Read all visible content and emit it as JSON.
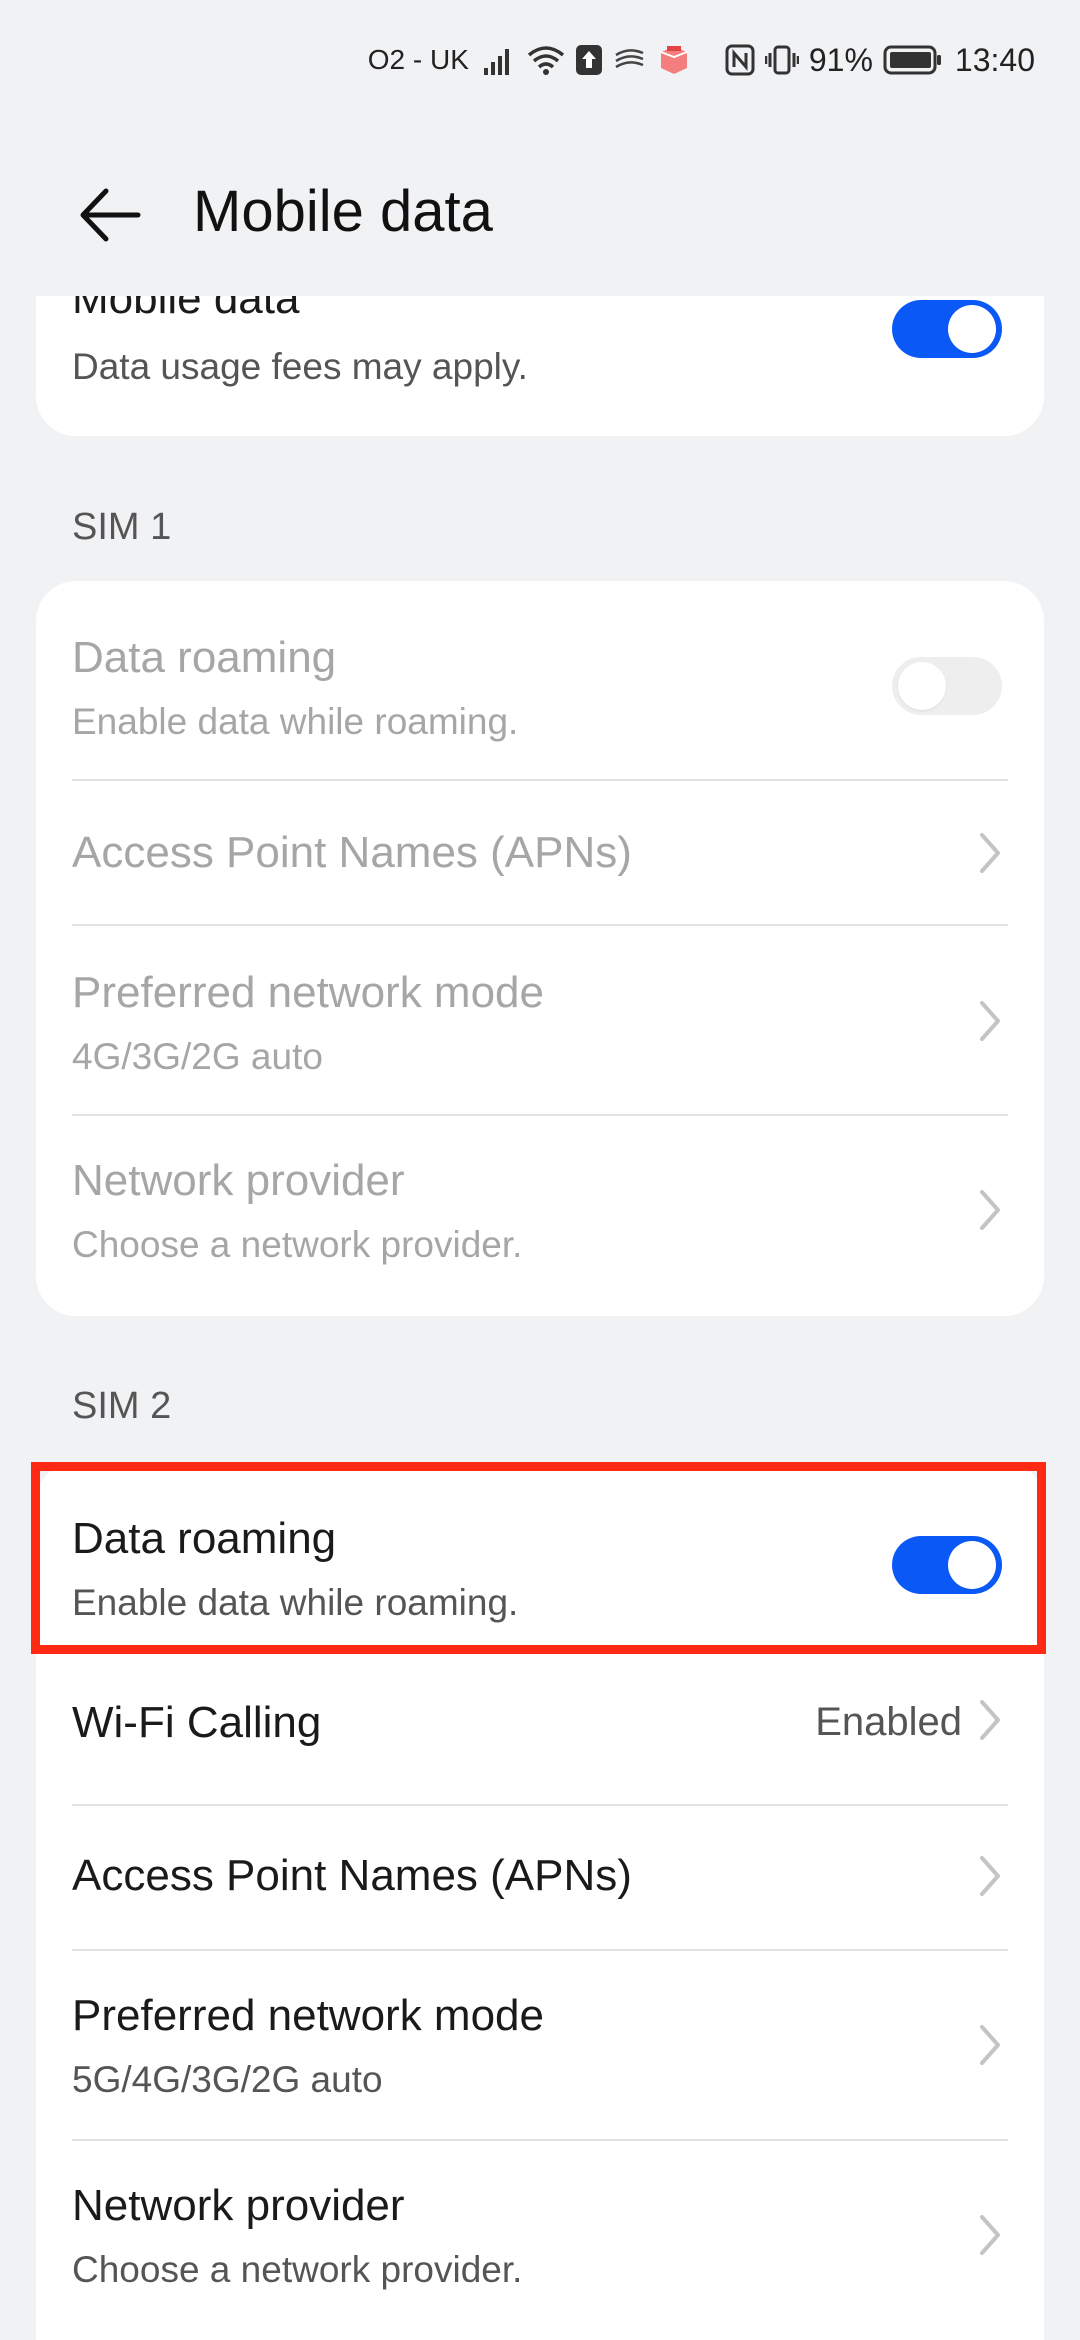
{
  "status_bar": {
    "carrier": "O2 - UK",
    "battery_percent": "91%",
    "time": "13:40",
    "icons": [
      "signal-icon",
      "wifi-icon",
      "upload-icon",
      "swiftkey-icon",
      "app-notification-icon",
      "nfc-icon",
      "vibrate-icon",
      "battery-icon"
    ]
  },
  "header": {
    "title": "Mobile data",
    "back_icon": "arrow-left-icon"
  },
  "mobile_data": {
    "title": "Mobile data",
    "subtitle": "Data usage fees may apply.",
    "enabled": true
  },
  "sim1": {
    "label": "SIM 1",
    "data_roaming": {
      "title": "Data roaming",
      "subtitle": "Enable data while roaming.",
      "enabled": false
    },
    "apn": {
      "title": "Access Point Names (APNs)"
    },
    "network_mode": {
      "title": "Preferred network mode",
      "subtitle": "4G/3G/2G auto"
    },
    "network_provider": {
      "title": "Network provider",
      "subtitle": "Choose a network provider."
    }
  },
  "sim2": {
    "label": "SIM 2",
    "data_roaming": {
      "title": "Data roaming",
      "subtitle": "Enable data while roaming.",
      "enabled": true
    },
    "wifi_calling": {
      "title": "Wi-Fi Calling",
      "value": "Enabled"
    },
    "apn": {
      "title": "Access Point Names (APNs)"
    },
    "network_mode": {
      "title": "Preferred network mode",
      "subtitle": "5G/4G/3G/2G auto"
    },
    "network_provider": {
      "title": "Network provider",
      "subtitle": "Choose a network provider."
    }
  },
  "colors": {
    "accent": "#0a59f7",
    "highlight": "#ff2a13",
    "background": "#f1f2f4"
  }
}
